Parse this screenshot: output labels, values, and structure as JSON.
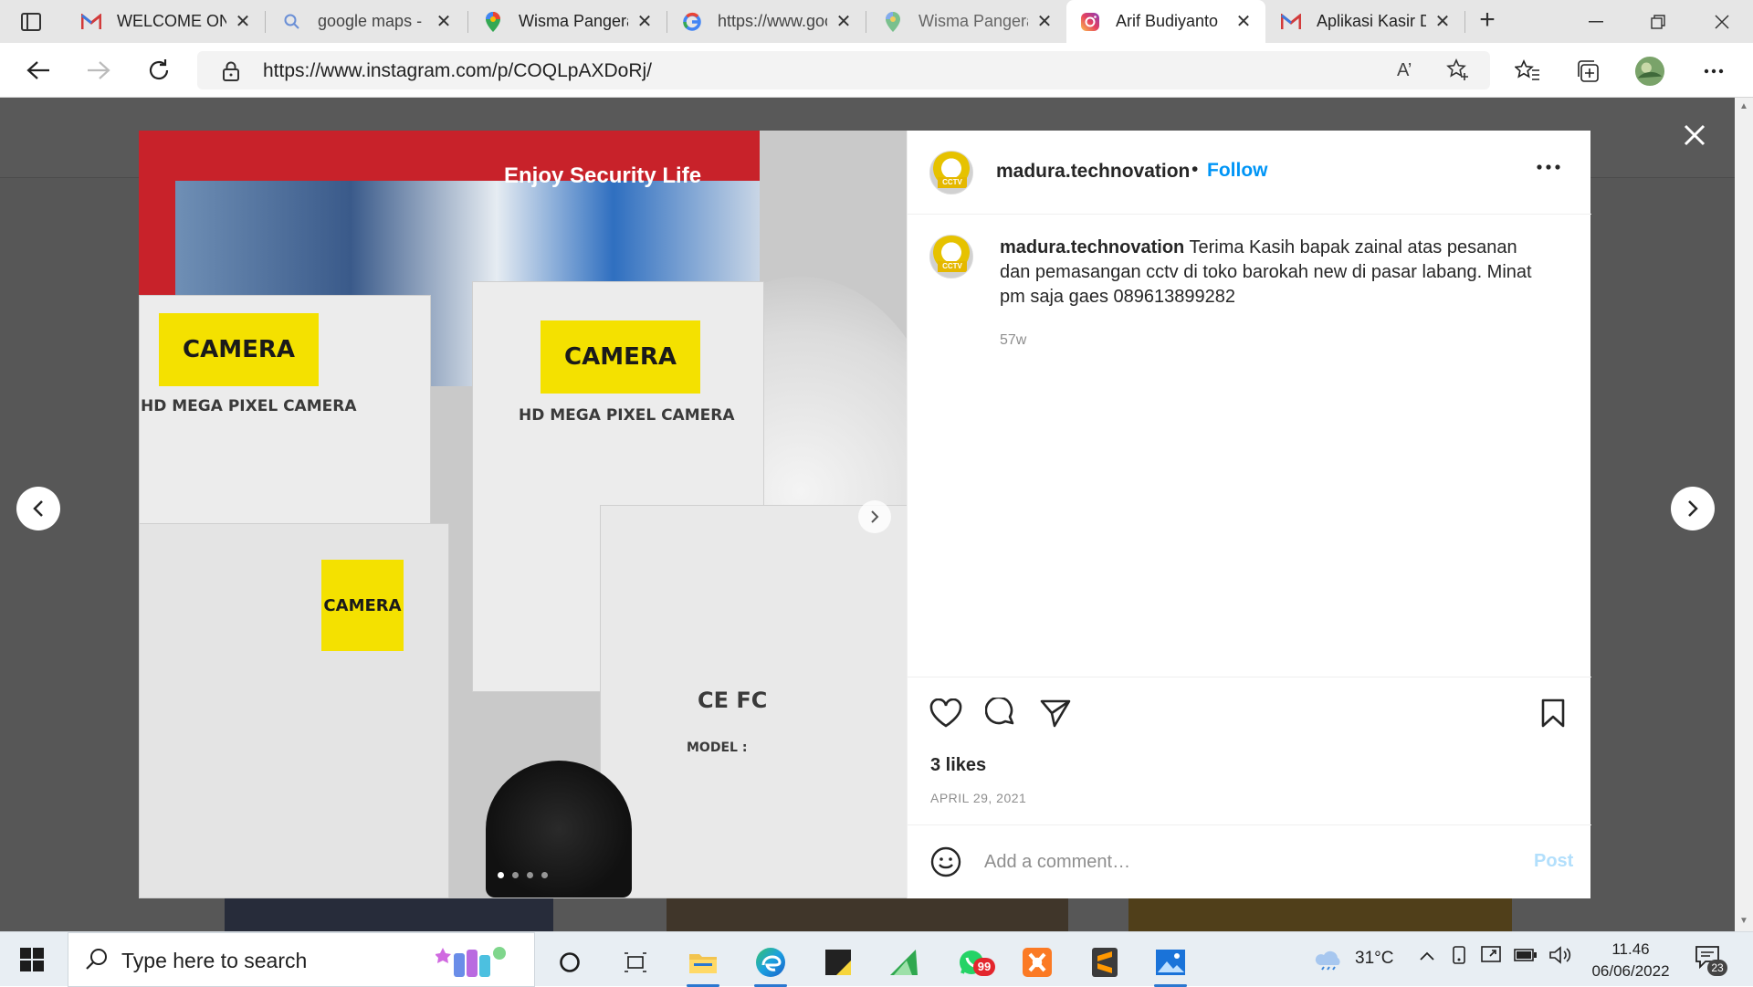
{
  "browser": {
    "tabs": [
      {
        "title": "WELCOME ONLINE",
        "icon": "gmail-multicolor-m-icon"
      },
      {
        "title": "google maps - Search",
        "icon": "search-icon"
      },
      {
        "title": "Wisma Pangeran",
        "icon": "maps-pin-icon"
      },
      {
        "title": "https://www.google",
        "icon": "google-g-icon"
      },
      {
        "title": "Wisma Pangeran",
        "icon": "maps-pin-icon"
      },
      {
        "title": "Arif Budiyanto",
        "icon": "instagram-icon",
        "active": true
      },
      {
        "title": "Aplikasi Kasir D",
        "icon": "gmail-multicolor-m-icon"
      }
    ],
    "url": "https://www.instagram.com/p/COQLpAXDoRj/",
    "read_aloud_label": "A’"
  },
  "post": {
    "username": "madura.technovation",
    "follow_label": "Follow",
    "separator": "•",
    "caption": "Terima Kasih bapak zainal atas pesanan dan pemasangan cctv di toko barokah new di pasar labang. Minat pm saja gaes 089613899282",
    "age": "57w",
    "likes": "3 likes",
    "date": "APRIL 29, 2021",
    "comment_placeholder": "Add a comment…",
    "post_label": "Post",
    "avatar_tag": "CCTV",
    "carousel": {
      "count": 4,
      "active_index": 0
    }
  },
  "photo": {
    "slogan": "Enjoy Security Life",
    "camera_label": "CAMERA",
    "box_heading": "HD MEGA PIXEL CAMERA",
    "model_label": "MODEL :",
    "cert_label": "CE FC"
  },
  "taskbar": {
    "search_placeholder": "Type here to search",
    "temperature": "31°C",
    "time": "11.46",
    "date": "06/06/2022",
    "notifications": "23",
    "whatsapp_badge": "99"
  },
  "colors": {
    "instagram_blue": "#0095f6",
    "post_disabled": "#b2dffc",
    "overlay": "rgba(0,0,0,0.65)",
    "taskbar_accent": "#2b78d0"
  }
}
